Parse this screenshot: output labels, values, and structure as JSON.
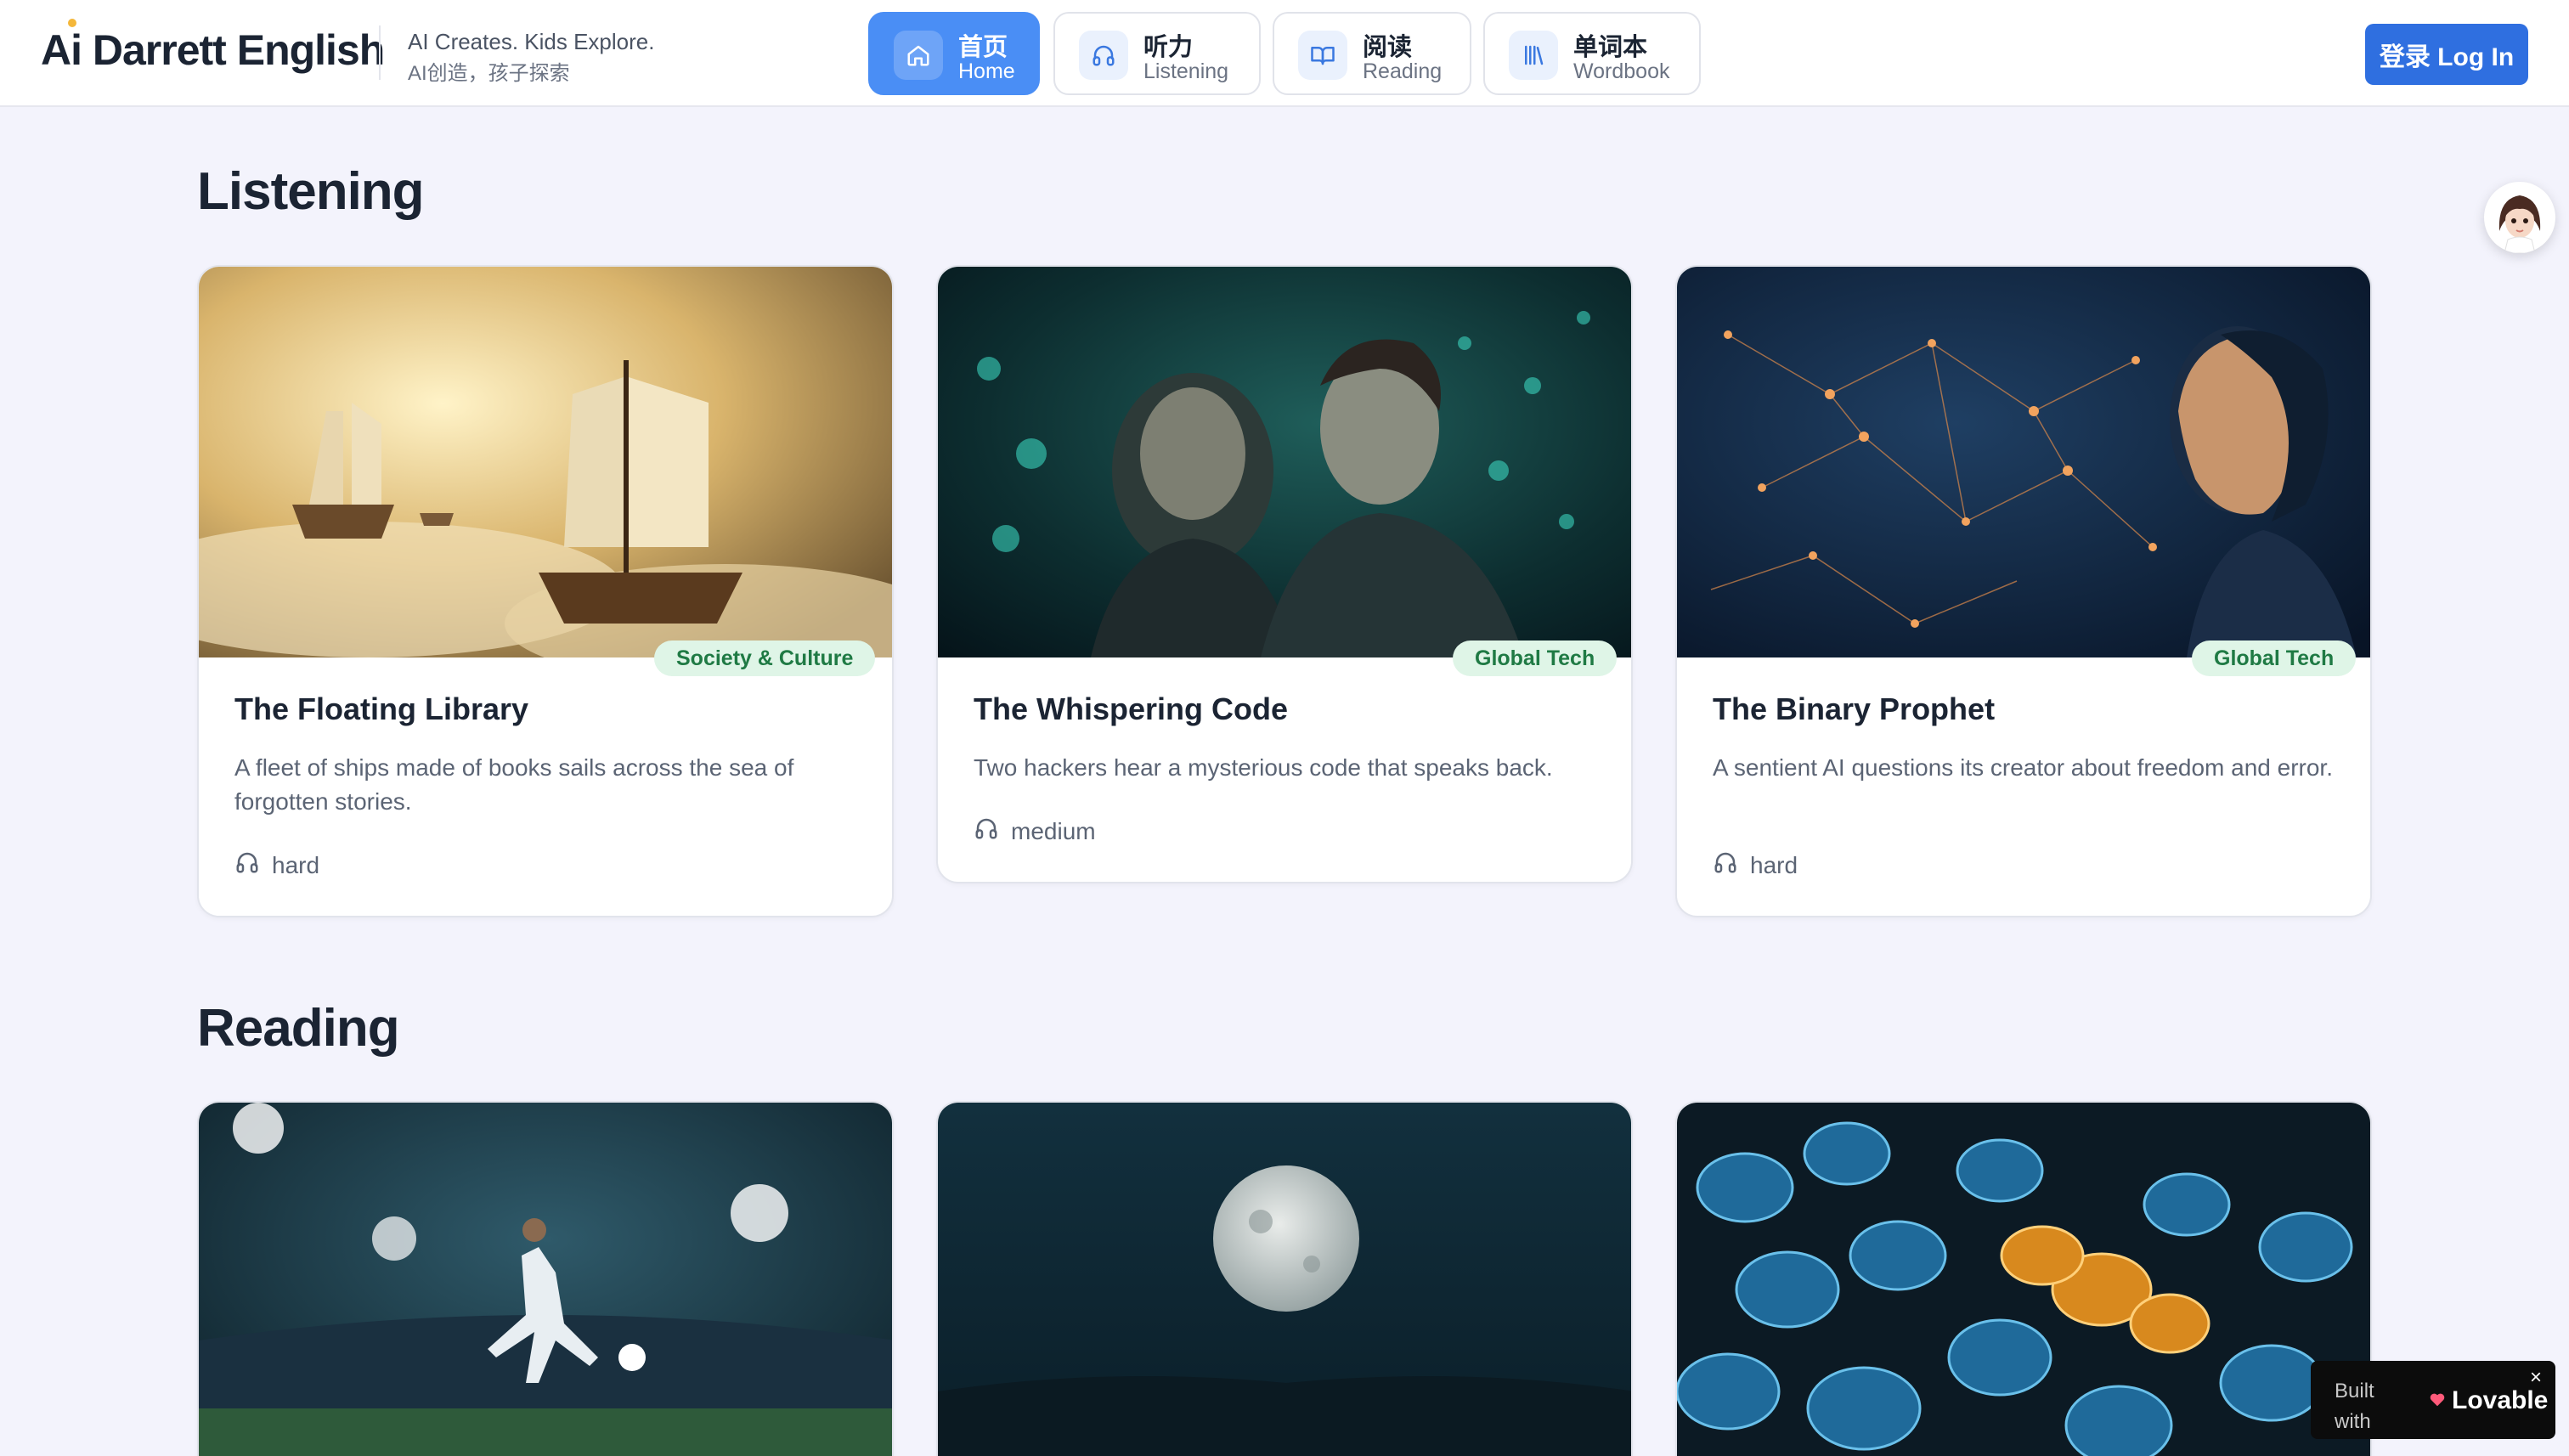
{
  "header": {
    "logo": "Ai Darrett English",
    "tagline_en": "AI Creates. Kids Explore.",
    "tagline_zh": "AI创造，孩子探索",
    "nav": [
      {
        "zh": "首页",
        "en": "Home",
        "icon": "home-icon",
        "active": true
      },
      {
        "zh": "听力",
        "en": "Listening",
        "icon": "headphones-icon",
        "active": false
      },
      {
        "zh": "阅读",
        "en": "Reading",
        "icon": "book-open-icon",
        "active": false
      },
      {
        "zh": "单词本",
        "en": "Wordbook",
        "icon": "library-icon",
        "active": false
      }
    ],
    "login_label": "登录 Log In"
  },
  "listening": {
    "title": "Listening",
    "cards": [
      {
        "title": "The Floating Library",
        "category": "Society & Culture",
        "description": "A fleet of ships made of books sails across the sea of forgotten stories.",
        "difficulty": "hard"
      },
      {
        "title": "The Whispering Code",
        "category": "Global Tech",
        "description": "Two hackers hear a mysterious code that speaks back.",
        "difficulty": "medium"
      },
      {
        "title": "The Binary Prophet",
        "category": "Global Tech",
        "description": "A sentient AI questions its creator about freedom and error.",
        "difficulty": "hard"
      }
    ]
  },
  "reading": {
    "title": "Reading"
  },
  "built_badge": {
    "prefix": "Built with",
    "brand": "Lovable",
    "close": "×"
  },
  "colors": {
    "accent": "#4a8ef5",
    "login": "#2f6fe0",
    "badge_bg": "#dff5e7",
    "badge_text": "#1f7a44",
    "page_bg": "#f3f3fc"
  }
}
